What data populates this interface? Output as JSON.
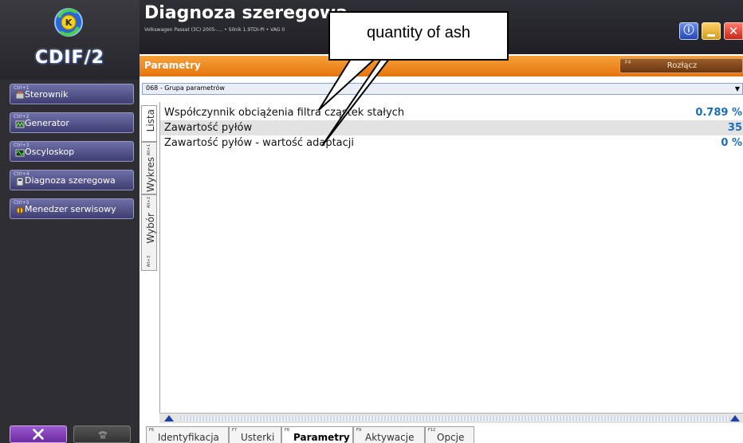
{
  "app": {
    "logo_text": "CDIF/2",
    "title": "Diagnoza szeregowa",
    "vehicle_info": "Volkswagen Passat (3C) 2005-.... • Silnik 1.9TDI-PI • VAG 0"
  },
  "sidebar": {
    "items": [
      {
        "hotkey": "Ctrl+1",
        "label": "Sterownik"
      },
      {
        "hotkey": "Ctrl+2",
        "label": "Generator"
      },
      {
        "hotkey": "Ctrl+3",
        "label": "Oscyloskop"
      },
      {
        "hotkey": "Ctrl+4",
        "label": "Diagnoza szeregowa"
      },
      {
        "hotkey": "Ctrl+5",
        "label": "Menedzer serwisowy"
      }
    ]
  },
  "toolbar": {
    "section_title": "Parametry",
    "disconnect_hotkey": "F4",
    "disconnect_label": "Rozłącz"
  },
  "group_select": {
    "value": "068 - Grupa parametrów"
  },
  "vertical_tabs": [
    {
      "hotkey": "Alt+1",
      "label": "Lista"
    },
    {
      "hotkey": "Alt+2",
      "label": "Wykres"
    },
    {
      "hotkey": "Alt+3",
      "label": "Wybór"
    }
  ],
  "parameters": [
    {
      "name": "Współczynnik obciążenia filtra cząstek stałych",
      "value": "0.789 %"
    },
    {
      "name": "Zawartość pyłów",
      "value": "35"
    },
    {
      "name": "Zawartość pyłów - wartość adaptacji",
      "value": "0 %"
    }
  ],
  "bottom_tabs": [
    {
      "hotkey": "F6",
      "label": "Identyfikacja"
    },
    {
      "hotkey": "F7",
      "label": "Usterki"
    },
    {
      "hotkey": "F8",
      "label": "Parametry"
    },
    {
      "hotkey": "F9",
      "label": "Aktywacje"
    },
    {
      "hotkey": "F12",
      "label": "Opcje"
    }
  ],
  "callout": {
    "text": "quantity of ash"
  },
  "colors": {
    "accent_orange": "#e5740e",
    "value_blue": "#1b6fb8",
    "sidebar_button": "#4f4f8a"
  }
}
